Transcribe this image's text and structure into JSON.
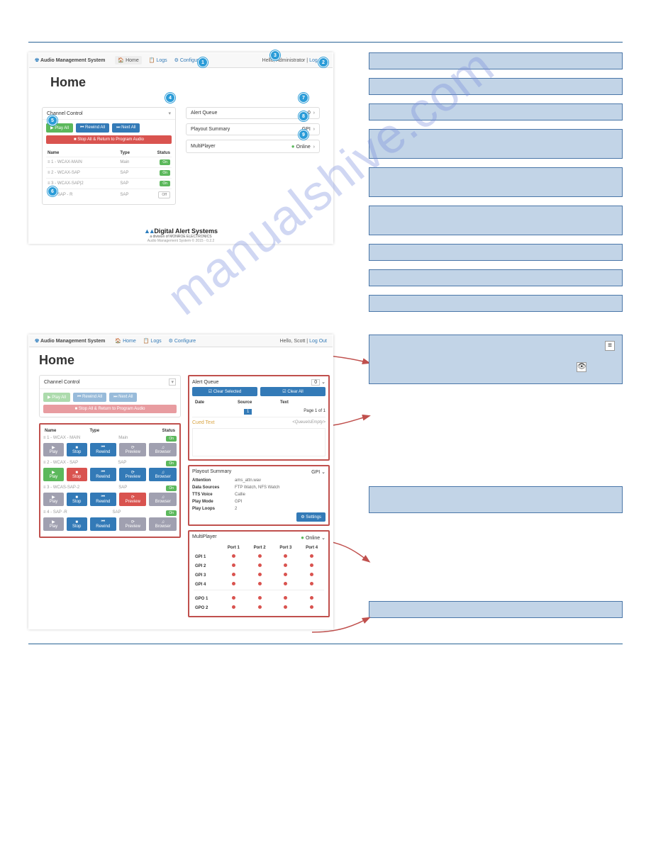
{
  "watermark": "manualshive.com",
  "section1": {
    "title": "",
    "nav": {
      "brand": "Audio Management System",
      "home": "Home",
      "logs": "Logs",
      "configure": "Configure",
      "greeting": "Hello, Administrator",
      "logout": "Log Out"
    },
    "page_title": "Home",
    "channel_control": {
      "header": "Channel Control",
      "play_all": "▶ Play All",
      "rewind_all": "⏮ Rewind All",
      "next_all": "⏭ Next All",
      "stop_all": "■ Stop All & Return to Program Audio",
      "cols": {
        "name": "Name",
        "type": "Type",
        "status": "Status"
      },
      "rows": [
        {
          "name": "≡ 1 - WCAX-MAIN",
          "type": "Main",
          "status": "On"
        },
        {
          "name": "≡ 2 - WCAX-SAP",
          "type": "SAP",
          "status": "On"
        },
        {
          "name": "≡ 3 - WCAX-SAP|2",
          "type": "SAP",
          "status": "On"
        },
        {
          "name": "≡ 4 - SAP - R",
          "type": "SAP",
          "status": "Off"
        }
      ]
    },
    "alert_queue": {
      "label": "Alert Queue",
      "count": "0"
    },
    "playout": {
      "label": "Playout Summary",
      "mode": "GPI"
    },
    "multiplayer": {
      "label": "MultiPlayer",
      "status": "Online"
    },
    "footer": {
      "brand": "Digital Alert Systems",
      "sub": "a division of MONROE ELECTRONICS",
      "ver": "Audio Management System © 2015 - 0.2.2"
    },
    "bubbles": [
      "1",
      "2",
      "3",
      "4",
      "5",
      "6",
      "7",
      "8",
      "9"
    ]
  },
  "anno1": [
    {
      "txt": ""
    },
    {
      "txt": ""
    },
    {
      "txt": ""
    },
    {
      "txt": ""
    },
    {
      "txt": ""
    },
    {
      "txt": ""
    },
    {
      "txt": ""
    },
    {
      "txt": ""
    },
    {
      "txt": ""
    }
  ],
  "section2": {
    "title": "",
    "nav": {
      "brand": "Audio Management System",
      "home": "Home",
      "logs": "Logs",
      "configure": "Configure",
      "greeting": "Hello, Scott",
      "logout": "Log Out"
    },
    "page_title": "Home",
    "channel_control": {
      "header": "Channel Control",
      "play_all": "▶ Play All",
      "rewind_all": "⏮ Rewind All",
      "next_all": "⏭ Next All",
      "stop_all": "■ Stop All & Return to Program Audio",
      "row_btns": {
        "play": "▶ Play",
        "stop": "■ Stop",
        "rewind": "⏮ Rewind",
        "preview": "⟳ Preview",
        "browser": "♫ Browser"
      },
      "rows": [
        {
          "name": "≡ 1 - WCAX - MAIN",
          "type": "Main"
        },
        {
          "name": "≡ 2 - WCAX - SAP",
          "type": "SAP"
        },
        {
          "name": "≡ 3 - WCAS-SAP-2",
          "type": "SAP"
        },
        {
          "name": "≡ 4 - SAP -R",
          "type": "SAP"
        }
      ],
      "cols": {
        "name": "Name",
        "type": "Type",
        "status": "Status"
      }
    },
    "alert_queue": {
      "header": "Alert Queue",
      "count": "0",
      "clear_sel": "☑ Clear Selected",
      "clear_all": "☑ Clear All",
      "cols": {
        "date": "Date",
        "source": "Source",
        "text": "Text"
      },
      "page": "Page 1 of 1",
      "queued_text": "Cued Text",
      "empty": "<QueueIsEmpty>"
    },
    "playout_summary": {
      "header": "Playout Summary",
      "mode": "GPI",
      "attention": {
        "k": "Attention",
        "v": "ams_attn.wav"
      },
      "datasources": {
        "k": "Data Sources",
        "v": "FTP Watch, NFS Watch"
      },
      "tts": {
        "k": "TTS Voice",
        "v": "Callie"
      },
      "playmode": {
        "k": "Play Mode",
        "v": "GPI"
      },
      "loops": {
        "k": "Play Loops",
        "v": "2"
      },
      "settings": "⚙ Settings"
    },
    "multiplayer": {
      "header": "MultiPlayer",
      "status": "Online",
      "ports": [
        "Port 1",
        "Port 2",
        "Port 3",
        "Port 4"
      ],
      "gpi": [
        "GPI 1",
        "GPI 2",
        "GPI 3",
        "GPI 4"
      ],
      "gpo": [
        "GPO 1",
        "GPO 2"
      ]
    }
  },
  "anno2": [
    {
      "txt": "",
      "icons": [
        "list",
        "eye"
      ]
    },
    {
      "txt": ""
    },
    {
      "txt": ""
    },
    {
      "txt": ""
    }
  ]
}
